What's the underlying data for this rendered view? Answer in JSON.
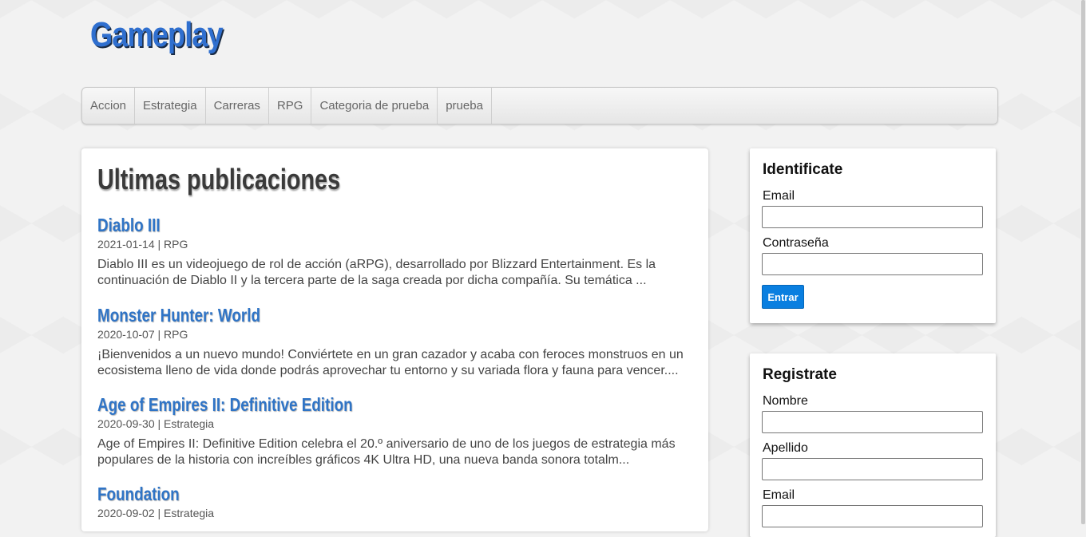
{
  "site": {
    "logo": "Gameplay"
  },
  "nav": {
    "items": [
      {
        "label": "Accion"
      },
      {
        "label": "Estrategia"
      },
      {
        "label": "Carreras"
      },
      {
        "label": "RPG"
      },
      {
        "label": "Categoria de prueba"
      },
      {
        "label": "prueba"
      }
    ]
  },
  "main": {
    "title": "Ultimas publicaciones",
    "posts": [
      {
        "title": "Diablo III",
        "meta": "2021-01-14 | RPG",
        "excerpt": "Diablo III es un videojuego de rol de acción (aRPG), desarrollado por Blizzard Entertainment. Es la continuación de Diablo II y la tercera parte de la saga creada por dicha compañía. Su temática ..."
      },
      {
        "title": "Monster Hunter: World",
        "meta": "2020-10-07 | RPG",
        "excerpt": "¡Bienvenidos a un nuevo mundo! Conviértete en un gran cazador y acaba con feroces monstruos en un ecosistema lleno de vida donde podrás aprovechar tu entorno y su variada flora y fauna para vencer...."
      },
      {
        "title": "Age of Empires II: Definitive Edition",
        "meta": "2020-09-30 | Estrategia",
        "excerpt": "Age of Empires II: Definitive Edition celebra el 20.º aniversario de uno de los juegos de estrategia más populares de la historia con increíbles gráficos 4K Ultra HD, una nueva banda sonora totalm..."
      },
      {
        "title": "Foundation",
        "meta": "2020-09-02 | Estrategia",
        "excerpt": ""
      }
    ]
  },
  "login": {
    "title": "Identificate",
    "email_label": "Email",
    "email_value": "",
    "password_label": "Contraseña",
    "password_value": "",
    "submit_label": "Entrar"
  },
  "register": {
    "title": "Registrate",
    "name_label": "Nombre",
    "surname_label": "Apellido",
    "email_label": "Email"
  },
  "colors": {
    "accent": "#2f74c6",
    "button": "#0a7fe0"
  }
}
